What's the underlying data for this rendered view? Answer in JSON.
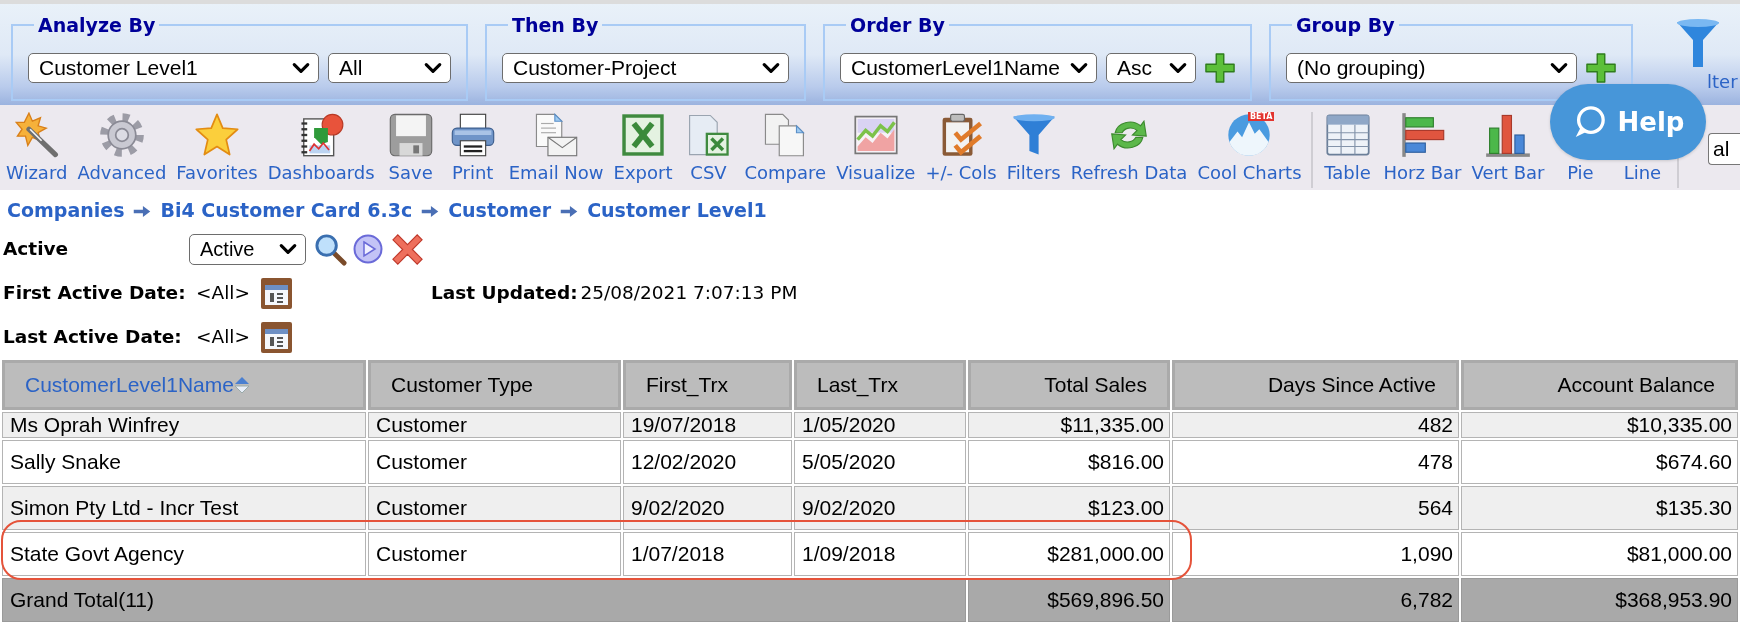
{
  "filter_bar": {
    "panels": [
      {
        "title": "Analyze By",
        "dropdowns": [
          {
            "value": "Customer Level1"
          },
          {
            "value": "All"
          }
        ],
        "add_button": false
      },
      {
        "title": "Then By",
        "dropdowns": [
          {
            "value": "Customer-Project"
          }
        ],
        "add_button": false
      },
      {
        "title": "Order By",
        "dropdowns": [
          {
            "value": "CustomerLevel1Name"
          },
          {
            "value": "Asc"
          }
        ],
        "add_button": true
      },
      {
        "title": "Group By",
        "dropdowns": [
          {
            "value": "(No grouping)"
          }
        ],
        "add_button": true
      }
    ],
    "filter_button": {
      "label": "lter"
    }
  },
  "toolbar": {
    "groups": [
      {
        "items": [
          {
            "label": "Wizard"
          },
          {
            "label": "Advanced"
          },
          {
            "label": "Favorites"
          },
          {
            "label": "Dashboards"
          },
          {
            "label": "Save"
          },
          {
            "label": "Print"
          },
          {
            "label": "Email Now"
          },
          {
            "label": "Export"
          },
          {
            "label": "CSV"
          },
          {
            "label": "Compare"
          },
          {
            "label": "Visualize"
          },
          {
            "label": "+/- Cols"
          },
          {
            "label": "Filters"
          },
          {
            "label": "Refresh Data"
          },
          {
            "label": "Cool Charts",
            "badge": "BETA"
          }
        ]
      },
      {
        "items": [
          {
            "label": "Table"
          },
          {
            "label": "Horz Bar"
          },
          {
            "label": "Vert Bar"
          },
          {
            "label": "Pie"
          },
          {
            "label": "Line"
          }
        ]
      }
    ],
    "view_dropdown": {
      "value": "al"
    }
  },
  "help_button": {
    "label": "Help"
  },
  "breadcrumb": [
    "Companies",
    "Bi4 Customer Card 6.3c",
    "Customer",
    "Customer Level1"
  ],
  "parameters": {
    "active": {
      "label": "Active",
      "value": "Active"
    },
    "first_active_date": {
      "label": "First Active Date:",
      "value": "<All>"
    },
    "last_updated": {
      "label": "Last Updated:",
      "value": "25/08/2021 7:07:13 PM"
    },
    "last_active_date": {
      "label": "Last Active Date:",
      "value": "<All>"
    }
  },
  "table": {
    "columns": [
      {
        "label": "CustomerLevel1Name",
        "kind": "text",
        "sorted": true
      },
      {
        "label": "Customer Type",
        "kind": "text",
        "sorted": false
      },
      {
        "label": "First_Trx",
        "kind": "text",
        "sorted": false
      },
      {
        "label": "Last_Trx",
        "kind": "text",
        "sorted": false
      },
      {
        "label": "Total Sales",
        "kind": "number",
        "sorted": false
      },
      {
        "label": "Days Since Active",
        "kind": "number",
        "sorted": false
      },
      {
        "label": "Account Balance",
        "kind": "number",
        "sorted": false
      }
    ],
    "rows": [
      {
        "cells": [
          "Ms Oprah Winfrey",
          "Customer",
          "19/07/2018",
          "1/05/2020",
          "$11,335.00",
          "482",
          "$10,335.00"
        ],
        "highlighted": false
      },
      {
        "cells": [
          "Sally Snake",
          "Customer",
          "12/02/2020",
          "5/05/2020",
          "$816.00",
          "478",
          "$674.60"
        ],
        "highlighted": false
      },
      {
        "cells": [
          "Simon Pty Ltd - Incr Test",
          "Customer",
          "9/02/2020",
          "9/02/2020",
          "$123.00",
          "564",
          "$135.30"
        ],
        "highlighted": false
      },
      {
        "cells": [
          "State Govt Agency",
          "Customer",
          "1/07/2018",
          "1/09/2018",
          "$281,000.00",
          "1,090",
          "$81,000.00"
        ],
        "highlighted": true
      }
    ],
    "footer": {
      "label": "Grand Total(11)",
      "cells": [
        "$569,896.50",
        "6,782",
        "$368,953.90"
      ]
    }
  }
}
